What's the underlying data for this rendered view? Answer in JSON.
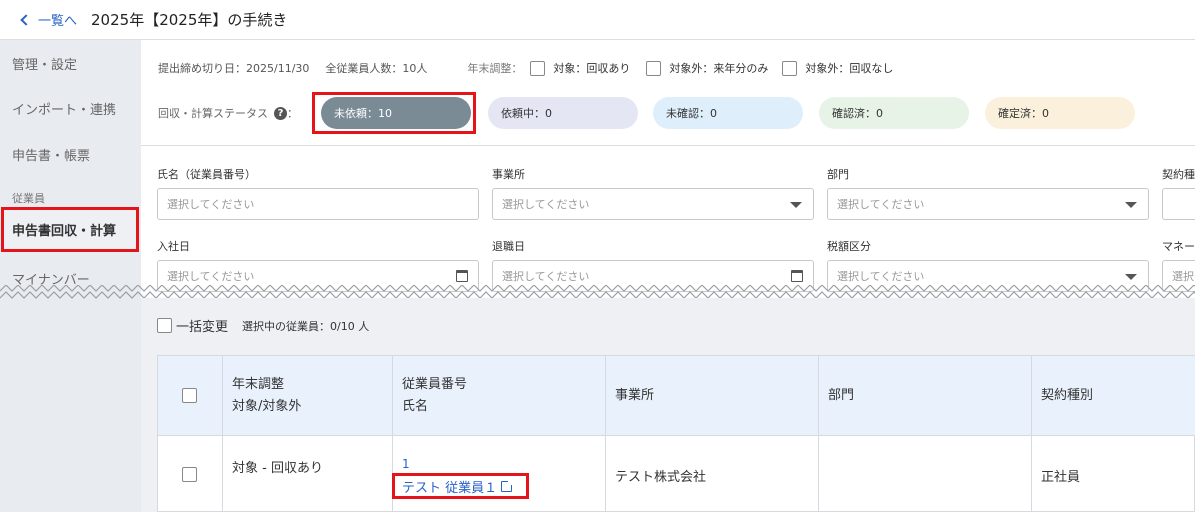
{
  "header": {
    "back_label": "一覧へ",
    "title": "2025年【2025年】の手続き"
  },
  "sidebar": {
    "items": [
      {
        "label": "管理・設定"
      },
      {
        "label": "インポート・連携"
      },
      {
        "label": "申告書・帳票"
      }
    ],
    "section_label": "従業員",
    "active_item": "申告書回収・計算",
    "bottom_item": "マイナンバー"
  },
  "meta": {
    "deadline": "提出締め切り日：2025/11/30",
    "total_employees": "全従業員人数：10人",
    "year_end_label": "年末調整：",
    "options": [
      {
        "label": "対象：回収あり"
      },
      {
        "label": "対象外：来年分のみ"
      },
      {
        "label": "対象外：回収なし"
      }
    ]
  },
  "status": {
    "label": "回収・計算ステータス",
    "colon": "：",
    "pills": [
      {
        "label": "未依頼：10"
      },
      {
        "label": "依頼中：0"
      },
      {
        "label": "未確認：0"
      },
      {
        "label": "確認済：0"
      },
      {
        "label": "確定済：0"
      }
    ]
  },
  "filters": {
    "name_label": "氏名（従業員番号）",
    "office_label": "事業所",
    "dept_label": "部門",
    "contract_label": "契約種",
    "hire_label": "入社日",
    "retire_label": "退職日",
    "tax_label": "税額区分",
    "mynumber_label": "マネー",
    "placeholder": "選択してください",
    "placeholder_short": "選択"
  },
  "bulk": {
    "label": "一括変更",
    "selected": "選択中の従業員：0/10 人"
  },
  "table": {
    "headers": {
      "year_end_1": "年末調整",
      "year_end_2": "対象/対象外",
      "emp_1": "従業員番号",
      "emp_2": "氏名",
      "office": "事業所",
      "dept": "部門",
      "contract": "契約種別"
    },
    "rows": [
      {
        "year_end": "対象 - 回収あり",
        "emp_no": "1",
        "name": "テスト 従業員１",
        "office": "テスト株式会社",
        "dept": "",
        "contract": "正社員"
      }
    ]
  }
}
